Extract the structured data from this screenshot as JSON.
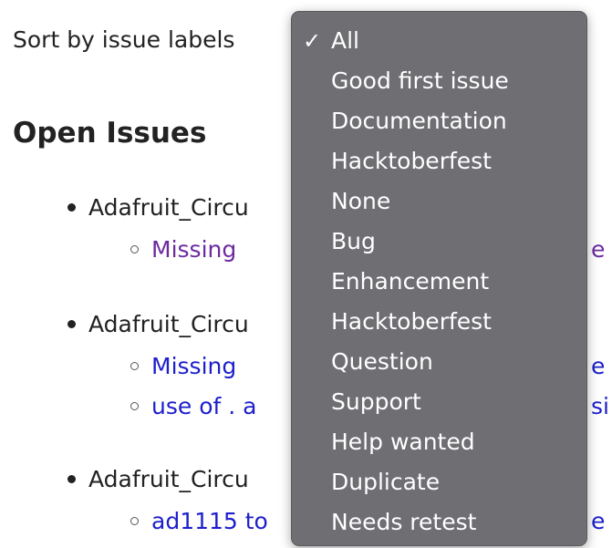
{
  "sort": {
    "label": "Sort by issue labels",
    "selected": "All",
    "options": [
      "All",
      "Good first issue",
      "Documentation",
      "Hacktoberfest",
      "None",
      "Bug",
      "Enhancement",
      "Hacktoberfest",
      "Question",
      "Support",
      "Help wanted",
      "Duplicate",
      "Needs retest"
    ]
  },
  "icons": {
    "check": "✓"
  },
  "main": {
    "title": "Open Issues",
    "groups": [
      {
        "repo": "Adafruit_Circu",
        "issues": [
          {
            "text": "Missing ",
            "tail": "e",
            "state": "visited"
          }
        ]
      },
      {
        "repo": "Adafruit_Circu",
        "issues": [
          {
            "text": "Missing ",
            "tail": "e",
            "state": "unvisited"
          },
          {
            "text": "use of . a",
            "tail": "si",
            "state": "unvisited"
          }
        ]
      },
      {
        "repo": "Adafruit_Circu",
        "issues": [
          {
            "text": "ad1115 to",
            "tail": "e",
            "state": "unvisited"
          }
        ]
      }
    ]
  },
  "colors": {
    "visited_link": "#6d2aa0",
    "unvisited_link": "#1d1fcc",
    "menu_background": "#6e6e73",
    "menu_text": "#ffffff"
  }
}
